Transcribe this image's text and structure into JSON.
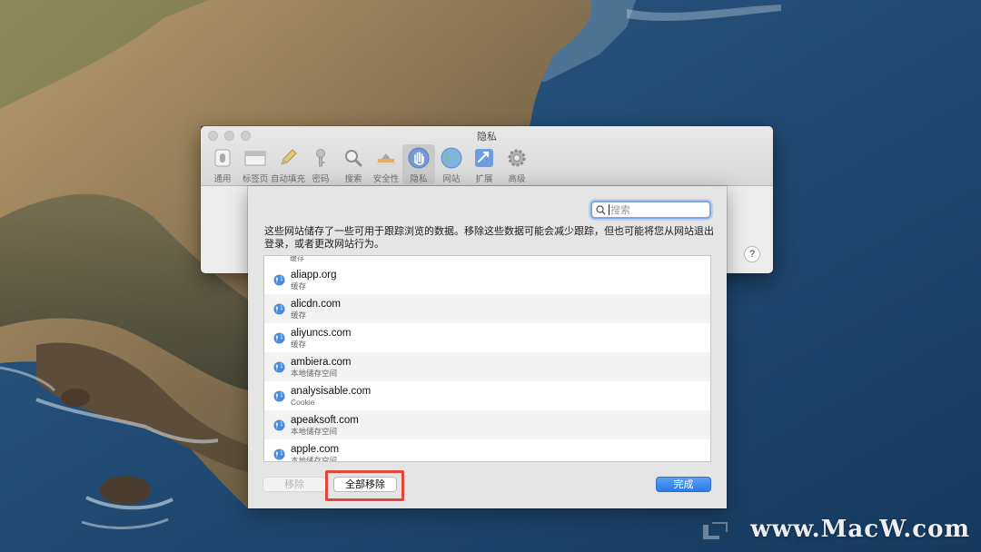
{
  "window": {
    "title": "隐私",
    "toolbar": [
      {
        "label": "通用",
        "icon": "switch-icon"
      },
      {
        "label": "标签页",
        "icon": "tabs-icon"
      },
      {
        "label": "自动填充",
        "icon": "pencil-icon"
      },
      {
        "label": "密码",
        "icon": "key-icon"
      },
      {
        "label": "搜索",
        "icon": "magnifier-icon"
      },
      {
        "label": "安全性",
        "icon": "security-icon"
      },
      {
        "label": "隐私",
        "icon": "hand-icon",
        "active": true
      },
      {
        "label": "网站",
        "icon": "globe-icon"
      },
      {
        "label": "扩展",
        "icon": "puzzle-icon"
      },
      {
        "label": "高级",
        "icon": "gear-icon"
      }
    ],
    "help": "?"
  },
  "sheet": {
    "search_placeholder": "搜索",
    "description": "这些网站储存了一些可用于跟踪浏览的数据。移除这些数据可能会减少跟踪，但也可能将您从网站退出登录，或者更改网站行为。",
    "top_fragment": "缓存",
    "sites": [
      {
        "domain": "aliapp.org",
        "kind": "缓存"
      },
      {
        "domain": "alicdn.com",
        "kind": "缓存"
      },
      {
        "domain": "aliyuncs.com",
        "kind": "缓存"
      },
      {
        "domain": "ambiera.com",
        "kind": "本地储存空间"
      },
      {
        "domain": "analysisable.com",
        "kind": "Cookie"
      },
      {
        "domain": "apeaksoft.com",
        "kind": "本地储存空间"
      },
      {
        "domain": "apple.com",
        "kind": "本地储存空间"
      }
    ],
    "buttons": {
      "remove": "移除",
      "remove_all": "全部移除",
      "done": "完成"
    }
  },
  "watermark": "www.MacW.com",
  "colors": {
    "accent": "#2b7ae7",
    "highlight": "#e2463d"
  }
}
